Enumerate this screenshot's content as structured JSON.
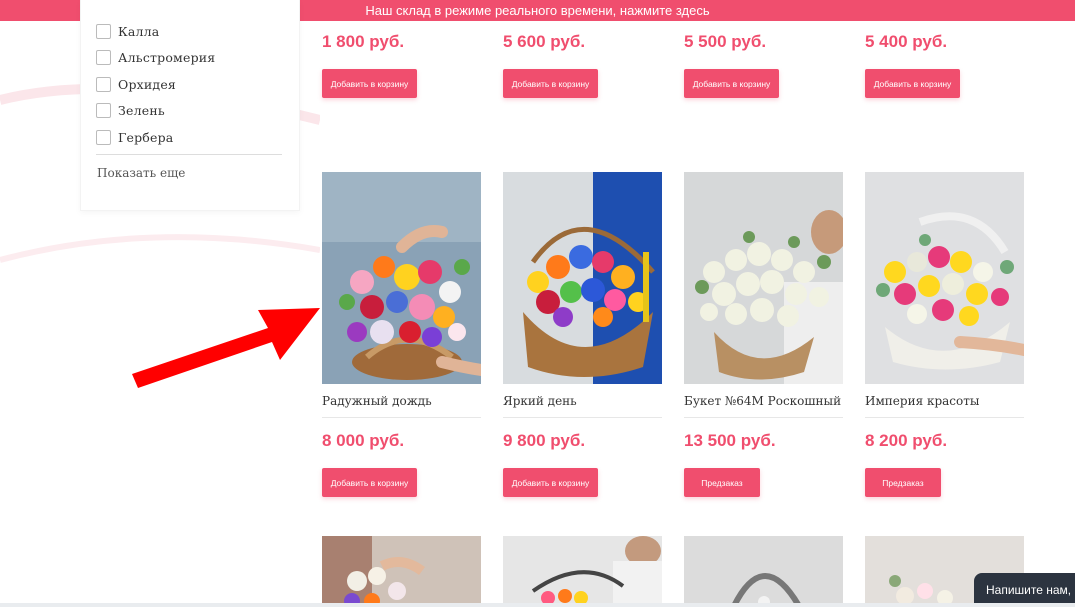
{
  "banner": {
    "text": "Наш склад в режиме реального времени, нажмите здесь"
  },
  "filters": {
    "items": [
      "Калла",
      "Альстромерия",
      "Орхидея",
      "Зелень",
      "Гербера"
    ],
    "show_more": "Показать еще"
  },
  "top_row": {
    "prices": [
      "1 800 руб.",
      "5 600 руб.",
      "5 500 руб.",
      "5 400 руб."
    ],
    "buttons": [
      "Добавить в корзину",
      "Добавить в корзину",
      "Добавить в корзину",
      "Добавить в корзину"
    ]
  },
  "products": [
    {
      "name": "Радужный дождь",
      "price": "8 000 руб.",
      "button": "Добавить в корзину"
    },
    {
      "name": "Яркий день",
      "price": "9 800 руб.",
      "button": "Добавить в корзину"
    },
    {
      "name": "Букет №64М Роскошный",
      "price": "13 500 руб.",
      "button": "Предзаказ"
    },
    {
      "name": "Империя красоты",
      "price": "8 200 руб.",
      "button": "Предзаказ"
    }
  ],
  "chat": {
    "label": "Напишите нам, мы онлайн!"
  },
  "colors": {
    "accent": "#f04e6e",
    "arrow": "#ff0000",
    "chat_bg": "#2c3440"
  }
}
